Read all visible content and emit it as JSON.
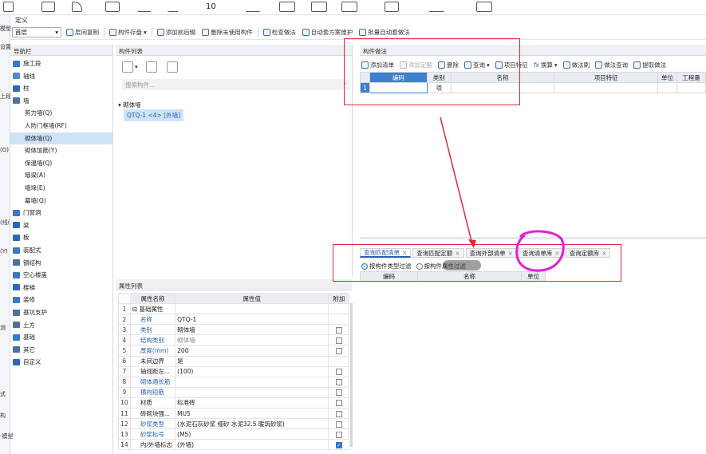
{
  "window": {
    "title": "定义"
  },
  "ribbon": {
    "labels": [
      "10"
    ]
  },
  "left_strip": {
    "labels": [
      "模型",
      "设置",
      "上段",
      "(O)",
      "",
      "(线(",
      "",
      "(Y)",
      "",
      "",
      "",
      "",
      "测",
      "",
      "",
      "",
      "式",
      "构",
      "-模型"
    ]
  },
  "toolbar": {
    "floor_select": "首层",
    "items": [
      "层间复制",
      "构件存盘",
      "添加前后缀",
      "删除未使用构件",
      "检查做法",
      "自动套方案维护",
      "批量自动套做法"
    ]
  },
  "nav": {
    "title": "导航栏",
    "items": [
      {
        "label": "施工段",
        "indent": 0,
        "icon": "construction-icon",
        "color": "#3a78c9"
      },
      {
        "label": "轴线",
        "indent": 0,
        "icon": "grid-icon",
        "color": "#4a8ad6"
      },
      {
        "label": "柱",
        "indent": 0,
        "icon": "column-icon",
        "color": "#2f68b8"
      },
      {
        "label": "墙",
        "indent": 0,
        "icon": "wall-icon",
        "color": "#4f6f9c"
      },
      {
        "label": "剪力墙(Q)",
        "indent": 1
      },
      {
        "label": "人防门框墙(RF)",
        "indent": 1
      },
      {
        "label": "砌体墙(Q)",
        "indent": 1,
        "selected": true
      },
      {
        "label": "砌体加筋(Y)",
        "indent": 1
      },
      {
        "label": "保温墙(Q)",
        "indent": 1
      },
      {
        "label": "暗梁(A)",
        "indent": 1
      },
      {
        "label": "墙垛(E)",
        "indent": 1
      },
      {
        "label": "幕墙(Q)",
        "indent": 1
      },
      {
        "label": "门窗洞",
        "indent": 0,
        "icon": "door-window-icon",
        "color": "#3a78c9"
      },
      {
        "label": "梁",
        "indent": 0,
        "icon": "beam-icon",
        "color": "#2f68b8"
      },
      {
        "label": "板",
        "indent": 0,
        "icon": "slab-icon",
        "color": "#2f68b8"
      },
      {
        "label": "装配式",
        "indent": 0,
        "icon": "prefab-icon",
        "color": "#3a78c9"
      },
      {
        "label": "钢结构",
        "indent": 0,
        "icon": "steel-icon",
        "color": "#4f6f9c"
      },
      {
        "label": "空心楼盖",
        "indent": 0,
        "icon": "hollow-floor-icon",
        "color": "#3a78c9"
      },
      {
        "label": "楼梯",
        "indent": 0,
        "icon": "stair-icon",
        "color": "#2f68b8"
      },
      {
        "label": "装修",
        "indent": 0,
        "icon": "decoration-icon",
        "color": "#3a78c9"
      },
      {
        "label": "基坑支护",
        "indent": 0,
        "icon": "support-icon",
        "color": "#4f6f9c"
      },
      {
        "label": "土方",
        "indent": 0,
        "icon": "earth-icon",
        "color": "#4f6f9c"
      },
      {
        "label": "基础",
        "indent": 0,
        "icon": "foundation-icon",
        "color": "#3a78c9"
      },
      {
        "label": "其它",
        "indent": 0,
        "icon": "other-icon",
        "color": "#4f6f9c"
      },
      {
        "label": "自定义",
        "indent": 0,
        "icon": "custom-icon",
        "color": "#2f68b8"
      }
    ]
  },
  "component_list": {
    "title": "构件列表",
    "search_placeholder": "搜索构件...",
    "group": "砌体墙",
    "item": "QTQ-1 <4> [外墙]"
  },
  "properties": {
    "title": "属性列表",
    "col_name": "属性名称",
    "col_value": "属性值",
    "col_attach": "附加",
    "rows": [
      {
        "n": "1",
        "name": "基础属性",
        "value": "",
        "blue": false,
        "cb": "none",
        "group": true
      },
      {
        "n": "2",
        "name": "名称",
        "value": "QTQ-1",
        "blue": true,
        "cb": "none"
      },
      {
        "n": "3",
        "name": "类别",
        "value": "砌体墙",
        "blue": true,
        "cb": "off"
      },
      {
        "n": "4",
        "name": "结构类别",
        "value": "砌体墙",
        "blue": true,
        "cb": "off"
      },
      {
        "n": "5",
        "name": "厚度(mm)",
        "value": "200",
        "blue": true,
        "cb": "off"
      },
      {
        "n": "6",
        "name": "未间边界",
        "value": "是",
        "blue": false,
        "cb": "none"
      },
      {
        "n": "7",
        "name": "轴线距左...",
        "value": "(100)",
        "blue": false,
        "cb": "off"
      },
      {
        "n": "8",
        "name": "砌体通长筋",
        "value": "",
        "blue": true,
        "cb": "off"
      },
      {
        "n": "9",
        "name": "横向短筋",
        "value": "",
        "blue": true,
        "cb": "off"
      },
      {
        "n": "10",
        "name": "材质",
        "value": "标准砖",
        "blue": false,
        "cb": "off"
      },
      {
        "n": "11",
        "name": "砖砌块强...",
        "value": "MU5",
        "blue": false,
        "cb": "off"
      },
      {
        "n": "12",
        "name": "砂浆类型",
        "value": "(水泥石灰砂浆 细砂 水泥32.5 暖筑砂浆)",
        "blue": true,
        "cb": "off"
      },
      {
        "n": "13",
        "name": "砂浆标号",
        "value": "(M5)",
        "blue": true,
        "cb": "off"
      },
      {
        "n": "14",
        "name": "内/外墙标志",
        "value": "(外墙)",
        "blue": false,
        "cb": "on"
      }
    ]
  },
  "method": {
    "title": "构件做法",
    "toolbar": [
      "添加清单",
      "添加定额",
      "删除",
      "查询",
      "项目特征",
      "换算",
      "做法刷",
      "做法查询",
      "提取做法"
    ],
    "headers": [
      "",
      "编码",
      "类别",
      "名称",
      "项目特征",
      "单位",
      "工程量"
    ],
    "row": {
      "n": "1",
      "code": "",
      "type": "项",
      "name": "",
      "feature": "",
      "unit": "",
      "qty": ""
    }
  },
  "query": {
    "tabs": [
      "查询匹配清单",
      "查询匹配定额",
      "查询外部清单",
      "查询清单库",
      "查询定额库"
    ],
    "radio_on": "按构件类型过滤",
    "radio_off": "按构件属性过滤",
    "headers": [
      "编码",
      "名称",
      "单位"
    ]
  },
  "colors": {
    "annotation": "#e0283a",
    "highlight": "#e020d0",
    "accent": "#2a5db0",
    "selection": "#cfe3f7"
  }
}
